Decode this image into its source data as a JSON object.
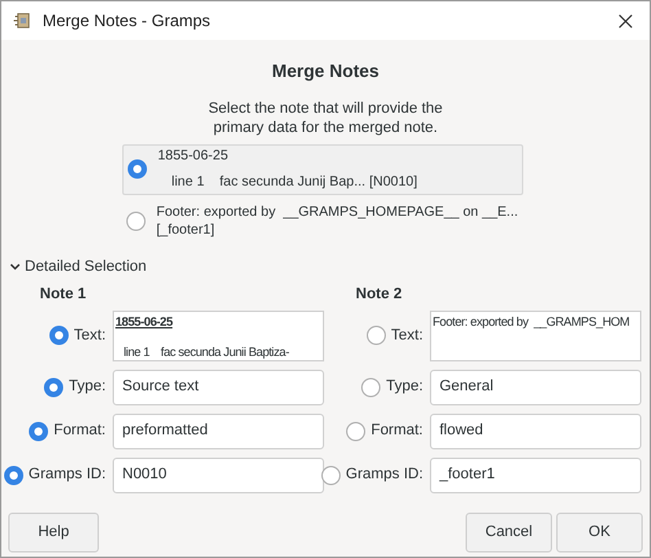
{
  "window": {
    "title": "Merge Notes - Gramps"
  },
  "heading": "Merge Notes",
  "description": [
    "Select the note that will provide the",
    "primary data for the merged note."
  ],
  "options": [
    {
      "selected": true,
      "lines": [
        "1855-06-25",
        "line 1    fac secunda Junij Bap... [N0010]"
      ]
    },
    {
      "selected": false,
      "lines": [
        "Footer: exported by  __GRAMPS_HOMEPAGE__ on __E...",
        "[_footer1]"
      ]
    }
  ],
  "detailed_selection": {
    "label": "Detailed Selection",
    "expanded": true
  },
  "notes": [
    {
      "title": "Note 1",
      "fields": [
        {
          "kind": "text",
          "label": "Text:",
          "selected": true,
          "lines": [
            {
              "kind": "heading",
              "text": "1855-06-25"
            },
            {
              "kind": "body",
              "text": "line 1    fac secunda Junii Baptiza-"
            }
          ]
        },
        {
          "kind": "entry",
          "label": "Type:",
          "selected": true,
          "value": "Source text"
        },
        {
          "kind": "entry",
          "label": "Format:",
          "selected": true,
          "value": "preformatted"
        },
        {
          "kind": "entry",
          "label": "Gramps ID:",
          "selected": true,
          "value": "N0010"
        }
      ]
    },
    {
      "title": "Note 2",
      "fields": [
        {
          "kind": "text",
          "label": "Text:",
          "selected": false,
          "lines": [
            {
              "kind": "body",
              "text": "Footer: exported by  __GRAMPS_HOM"
            }
          ]
        },
        {
          "kind": "entry",
          "label": "Type:",
          "selected": false,
          "value": "General"
        },
        {
          "kind": "entry",
          "label": "Format:",
          "selected": false,
          "value": "flowed"
        },
        {
          "kind": "entry",
          "label": "Gramps ID:",
          "selected": false,
          "value": "_footer1"
        }
      ]
    }
  ],
  "buttons": {
    "left": [
      "Help"
    ],
    "right": [
      "Cancel",
      "OK"
    ]
  }
}
